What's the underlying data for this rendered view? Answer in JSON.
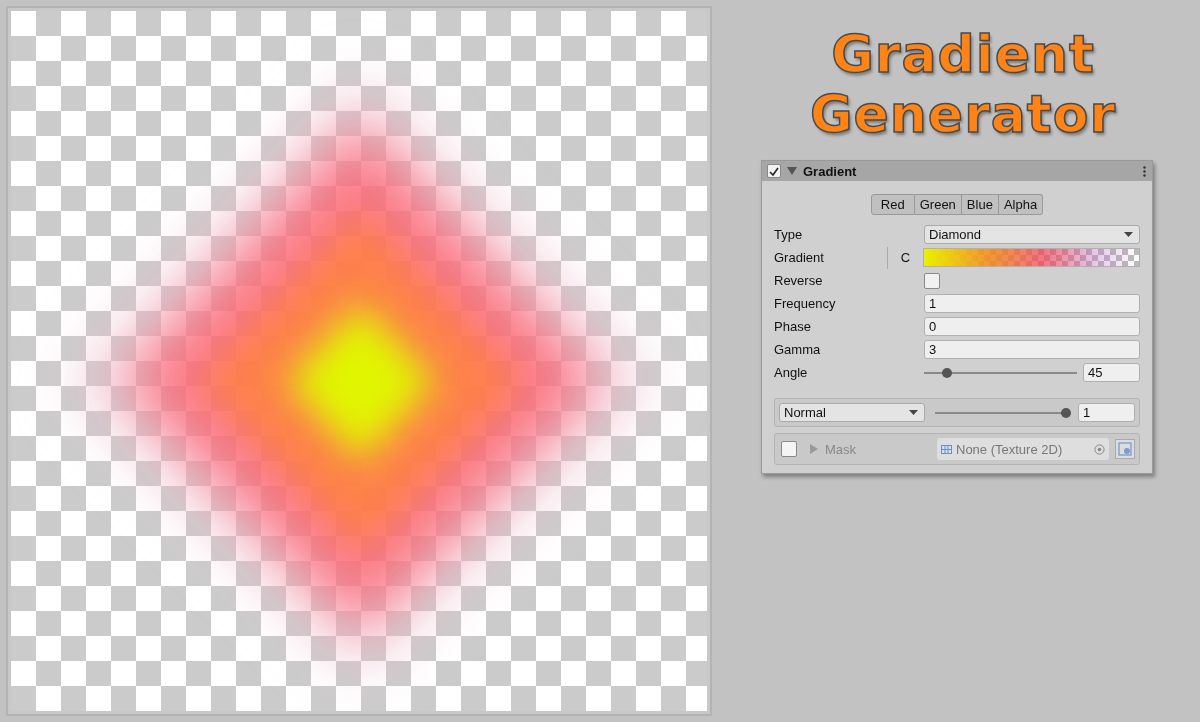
{
  "title_lines": [
    "Gradient",
    "Generator"
  ],
  "component": {
    "enabled": true,
    "expanded": true,
    "name": "Gradient"
  },
  "channel_tabs": [
    "Red",
    "Green",
    "Blue",
    "Alpha"
  ],
  "properties": [
    {
      "kind": "dropdown",
      "label": "Type",
      "value": "Diamond"
    },
    {
      "kind": "gradient",
      "label": "Gradient",
      "button": "C"
    },
    {
      "kind": "checkbox",
      "label": "Reverse",
      "checked": false
    },
    {
      "kind": "number",
      "label": "Frequency",
      "value": "1"
    },
    {
      "kind": "number",
      "label": "Phase",
      "value": "0"
    },
    {
      "kind": "number",
      "label": "Gamma",
      "value": "3"
    },
    {
      "kind": "slider",
      "label": "Angle",
      "level": 0.15,
      "value": "45"
    }
  ],
  "blend": {
    "mode": "Normal",
    "level": 1,
    "value": "1"
  },
  "mask": {
    "enabled": false,
    "expanded": false,
    "label": "Mask",
    "texture": "None (Texture 2D)"
  }
}
